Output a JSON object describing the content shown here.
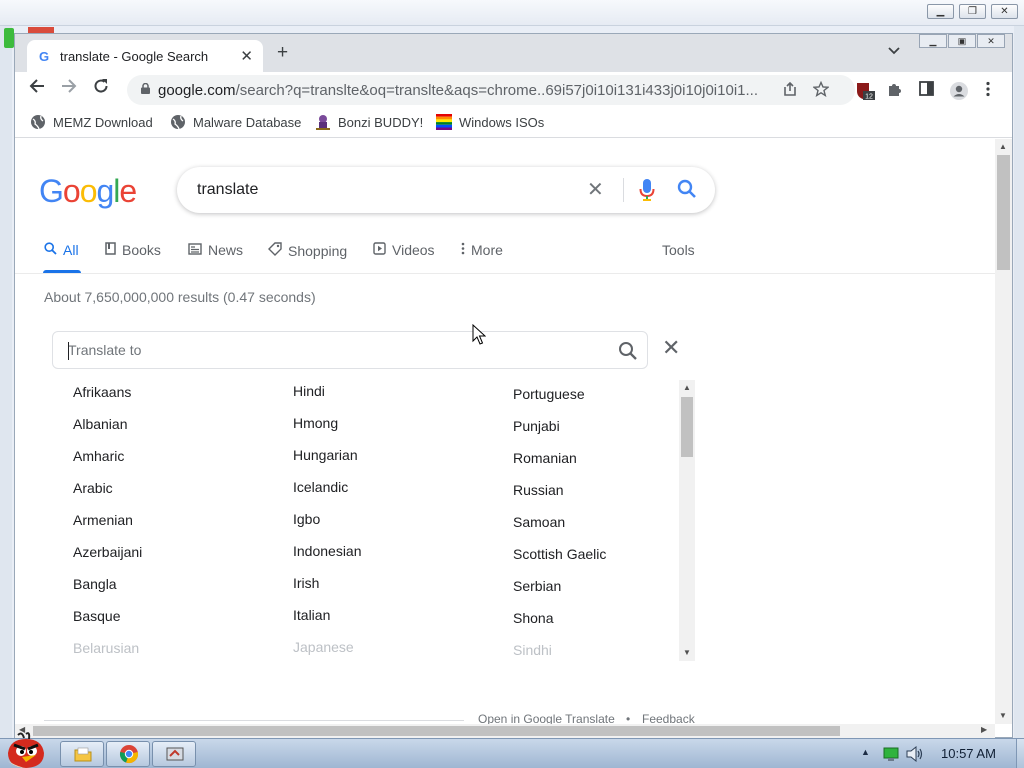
{
  "browser": {
    "tab": {
      "title": "translate - Google Search",
      "favicon": "G",
      "close": "✕"
    },
    "new_tab": "+",
    "tab_search": "⌄",
    "url_host": "google.com",
    "url_path": "/search?q=translte&oq=translte&aqs=chrome..69i57j0i10i131i433j0i10j0i10i1...",
    "extension_badge": "12",
    "bookmarks": [
      "MEMZ Download",
      "Malware Database",
      "Bonzi BUDDY!",
      "Windows ISOs"
    ]
  },
  "search": {
    "logo_letters": [
      {
        "ch": "G",
        "color": "#4285f4"
      },
      {
        "ch": "o",
        "color": "#ea4335"
      },
      {
        "ch": "o",
        "color": "#fbbc05"
      },
      {
        "ch": "g",
        "color": "#4285f4"
      },
      {
        "ch": "l",
        "color": "#34a853"
      },
      {
        "ch": "e",
        "color": "#ea4335"
      }
    ],
    "query": "translate",
    "clear": "✕",
    "tabs": [
      {
        "label": "All",
        "icon": "search-icon",
        "active": true
      },
      {
        "label": "Books",
        "icon": "book-icon"
      },
      {
        "label": "News",
        "icon": "news-icon"
      },
      {
        "label": "Shopping",
        "icon": "tag-icon"
      },
      {
        "label": "Videos",
        "icon": "play-icon"
      },
      {
        "label": "More",
        "icon": "more-vert-icon"
      }
    ],
    "tools": "Tools",
    "result_stats": "About 7,650,000,000 results (0.47 seconds)"
  },
  "translate": {
    "placeholder": "Translate to",
    "close": "✕",
    "columns": [
      [
        "Afrikaans",
        "Albanian",
        "Amharic",
        "Arabic",
        "Armenian",
        "Azerbaijani",
        "Bangla",
        "Basque",
        "Belarusian"
      ],
      [
        "Hindi",
        "Hmong",
        "Hungarian",
        "Icelandic",
        "Igbo",
        "Indonesian",
        "Irish",
        "Italian",
        "Japanese"
      ],
      [
        "Portuguese",
        "Punjabi",
        "Romanian",
        "Russian",
        "Samoan",
        "Scottish Gaelic",
        "Serbian",
        "Shona",
        "Sindhi"
      ]
    ],
    "open_link": "Open in Google Translate",
    "separator": "•",
    "feedback": "Feedback"
  },
  "taskbar": {
    "clock": "10:57 AM"
  },
  "colors": {
    "accent": "#1a73e8",
    "tab_strip": "#dee1e6"
  }
}
